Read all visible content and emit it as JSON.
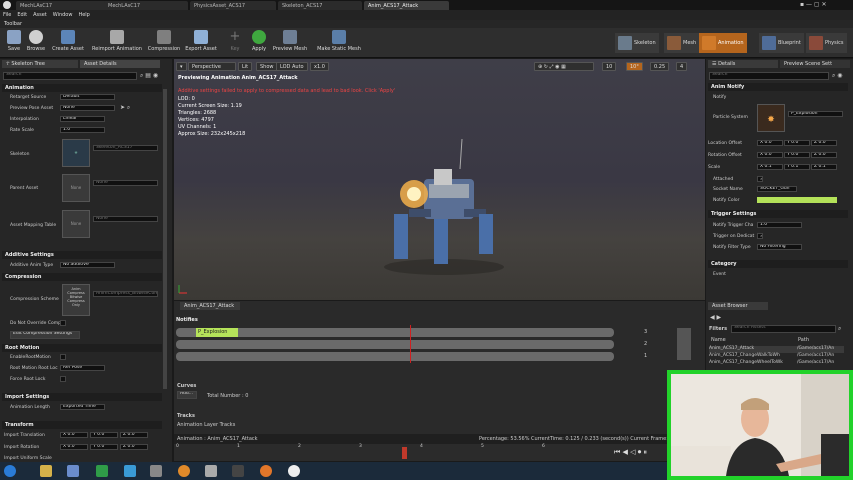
{
  "tabs": [
    "MechLAsC17",
    "MechLAsC17",
    "PhysicsAsset_ACS17",
    "Skeleton_ACS17",
    "Anim_ACS17_Attack"
  ],
  "menu": [
    "File",
    "Edit",
    "Asset",
    "Window",
    "Help"
  ],
  "toolbar_title": "Toolbar",
  "toolbar": [
    "Save",
    "Browse",
    "Create Asset",
    "Reimport Animation",
    "Compression",
    "Export Asset",
    "Key",
    "Apply",
    "Preview Mesh",
    "Make Static Mesh"
  ],
  "modes": [
    "Skeleton",
    "Mesh",
    "Animation",
    "Blueprint",
    "Physics"
  ],
  "left": {
    "tabs": [
      "Skeleton Tree",
      "Asset Details"
    ],
    "search_placeholder": "Search",
    "sections": {
      "animation": "Animation",
      "additive": "Additive Settings",
      "compression": "Compression",
      "root": "Root Motion",
      "import": "Import Settings",
      "transform": "Transform"
    },
    "rows": {
      "retarget": "Retarget Source",
      "retarget_val": "Default",
      "preview_pose": "Preview Pose Asset",
      "preview_pose_val": "None",
      "interp": "Interpolation",
      "interp_val": "Linear",
      "rate": "Rate Scale",
      "rate_val": "1.0",
      "skeleton": "Skeleton",
      "skeleton_val": "Skeleton_ACS17",
      "parent": "Parent Asset",
      "parent_thumb": "None",
      "parent_val": "None",
      "mapping": "Asset Mapping Table",
      "mapping_thumb": "None",
      "mapping_val": "None",
      "add_type": "Additive Anim Type",
      "add_type_val": "No additive",
      "comp_scheme": "Compression Scheme",
      "comp_thumb": "Anim Compress Bitwise Compress Only",
      "comp_val": "AnimCompress_BitwiseCom",
      "dont_override": "Do Not Override Comp",
      "edit_comp": "Edit Compression Settings",
      "enable_root": "EnableRootMotion",
      "root_lock": "Root Motion Root Loc",
      "root_lock_val": "Ref Pose",
      "force_lock": "Force Root Lock",
      "anim_len": "Animation Length",
      "anim_len_val": "Exported Time",
      "import_tr": "Import Translation",
      "import_rot": "Import Rotation",
      "import_unif": "Import Uniform Scale",
      "x": "X 0.0",
      "y": "Y 0.0",
      "z": "Z 0.0"
    }
  },
  "viewport": {
    "btns": [
      "Perspective",
      "Lit",
      "Show",
      "LOD Auto",
      "x1.0"
    ],
    "grid": [
      "10",
      "10°",
      "0.25",
      "4"
    ],
    "preview": "Previewing Animation Anim_ACS17_Attack",
    "warning": "Additive settings failed to apply to compressed data and lead to bad look. Click 'Apply'",
    "stats": [
      "LOD: 0",
      "Current Screen Size: 1.19",
      "Triangles: 2688",
      "Vertices: 4797",
      "UV Channels: 1",
      "Approx Size: 232x245x218"
    ]
  },
  "timeline": {
    "tab": "Anim_ACS17_Attack",
    "notifies": "Notifies",
    "notify_name": "P_Explosion",
    "track_nums": [
      "3",
      "2",
      "1"
    ],
    "curves": "Curves",
    "add": "Add...",
    "total": "Total Number : 0",
    "tracks": "Tracks",
    "layer": "Animation Layer Tracks",
    "anim": "Animation : Anim_ACS17_Attack",
    "percentage": "Percentage: 53.56% CurrentTime: 0.125 / 0.233 (second(s)) Current Frame: 3",
    "ticks": [
      "0",
      "1",
      "2",
      "3",
      "4",
      "5",
      "6"
    ]
  },
  "details": {
    "tabs": [
      "Details",
      "Preview Scene Sett"
    ],
    "search_placeholder": "Search",
    "anim_notify": "Anim Notify",
    "notify": "Notify",
    "particle": "Particle System",
    "particle_val": "P_Explosion",
    "loc": "Location Offset",
    "rot": "Rotation Offset",
    "scale": "Scale",
    "x0": "X 0.0",
    "y0": "Y 0.0",
    "z0": "Z 0.0",
    "x1": "X 0.1",
    "y1": "Y 0.1",
    "z1": "Z 0.1",
    "attached": "Attached",
    "socket": "Socket Name",
    "socket_val": "SOCKET_Gun",
    "color": "Notify Color",
    "trigger": "Trigger Settings",
    "trig_chance": "Notify Trigger Cha",
    "trig_chance_val": "1.0",
    "trig_ded": "Trigger on Dedicat",
    "filter": "Notify Filter Type",
    "filter_val": "No Filtering",
    "category": "Category",
    "event": "Event"
  },
  "browser": {
    "tab": "Asset Browser",
    "filters": "Filters",
    "search_placeholder": "Search Assets",
    "col_name": "Name",
    "col_path": "Path",
    "items": [
      {
        "name": "Anim_ACS17_Attack",
        "path": "/Game/acs17/An"
      },
      {
        "name": "Anim_ACS17_ChangeWalkToWh",
        "path": "/Game/acs17/An"
      },
      {
        "name": "Anim_ACS17_ChangeWheelToWk",
        "path": "/Game/acs17/An"
      }
    ]
  },
  "colors": {
    "accent": "#b5651d",
    "notify_color": "#b5e35a",
    "webcam_border": "#22d22a",
    "red": "#d02020"
  }
}
